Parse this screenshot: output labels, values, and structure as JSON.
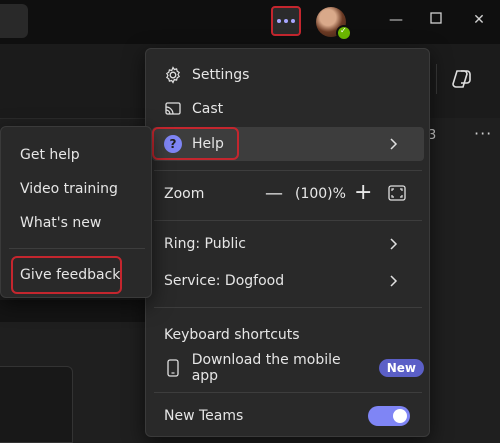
{
  "titlebar": {
    "more_options_label": "More options",
    "window_controls": [
      "minimize-icon",
      "maximize-icon",
      "close-icon"
    ]
  },
  "background": {
    "row_count": "3",
    "row_more": "···"
  },
  "menu": {
    "settings": "Settings",
    "cast": "Cast",
    "help": "Help",
    "zoom": {
      "label": "Zoom",
      "minus": "—",
      "value": "(100)%",
      "plus": "+"
    },
    "ring": "Ring: Public",
    "service": "Service: Dogfood",
    "keyboard_shortcuts": "Keyboard shortcuts",
    "download_mobile": "Download the mobile app",
    "new_badge": "New",
    "new_teams": "New Teams",
    "new_teams_enabled": true
  },
  "help_submenu": {
    "items": [
      "Get help",
      "Video training",
      "What's new"
    ],
    "feedback": "Give feedback"
  },
  "colors": {
    "accent": "#7f85f5",
    "badge": "#5b5fc7",
    "highlight_outline": "#c4262e",
    "presence": "#6bb700"
  }
}
